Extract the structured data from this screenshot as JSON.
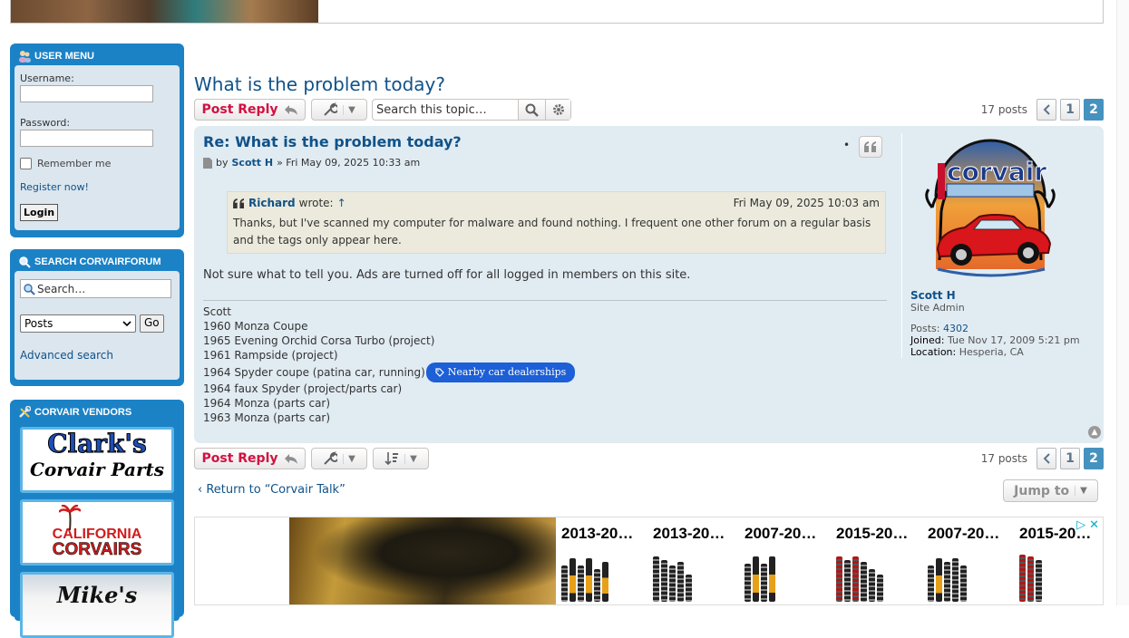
{
  "sidebar": {
    "user_menu": {
      "title": "User Menu",
      "username_label": "Username:",
      "password_label": "Password:",
      "remember_label": "Remember me",
      "register_link": "Register now!",
      "login_button": "Login"
    },
    "search": {
      "title": "Search Corvairforum",
      "placeholder": "Search…",
      "select_value": "Posts",
      "go_button": "Go",
      "advanced_link": "Advanced search"
    },
    "vendors": {
      "title": "Corvair Vendors",
      "items": [
        {
          "line1": "Clark's",
          "line2": "Corvair Parts"
        },
        {
          "line1": "CALIFORNIA",
          "line2": "CORVAIRS"
        },
        {
          "line1": "Mike's"
        }
      ]
    }
  },
  "topic": {
    "title": "What is the problem today?",
    "post_reply": "Post Reply",
    "search_placeholder": "Search this topic…",
    "post_count": "17 posts",
    "pages": [
      "1",
      "2"
    ],
    "current_page": "2"
  },
  "post": {
    "subject": "Re: What is the problem today?",
    "by": "by",
    "author": "Scott H",
    "date": "» Fri May 09, 2025 10:33 am",
    "quote": {
      "author": "Richard",
      "wrote": "wrote:",
      "arrow": "↑",
      "date": "Fri May 09, 2025 10:03 am",
      "text": "Thanks, but I've scanned my computer for malware and found nothing. I frequent one other forum on a regular basis and the tags only appear here."
    },
    "text": "Not sure what to tell you. Ads are turned off for all logged in members on this site.",
    "signature": [
      "Scott",
      "1960 Monza Coupe",
      "1965 Evening Orchid Corsa Turbo (project)",
      "1961 Rampside (project)",
      "1964 Spyder coupe (patina car, running)",
      "1964 faux Spyder (project/parts car)",
      "1964 Monza (parts car)",
      "1963 Monza (parts car)"
    ],
    "dealer_badge": "Nearby car dealerships",
    "profile": {
      "avatar_text": "corvair",
      "name": "Scott H",
      "rank": "Site Admin",
      "posts_label": "Posts:",
      "posts_value": "4302",
      "joined_label": "Joined:",
      "joined_value": "Tue Nov 17, 2009 5:21 pm",
      "location_label": "Location:",
      "location_value": "Hesperia, CA"
    }
  },
  "footer": {
    "return_link": "Return to “Corvair Talk”",
    "jump_to": "Jump to"
  },
  "ad": {
    "items": [
      "2013-20…",
      "2013-20…",
      "2007-20…",
      "2015-20…",
      "2007-20…",
      "2015-20…"
    ]
  },
  "colors": {
    "accent": "#105289",
    "sidebar": "#1b82c6",
    "post_bg": "#e1ebf2",
    "reply": "#d31141",
    "active_page": "#4692bf"
  }
}
